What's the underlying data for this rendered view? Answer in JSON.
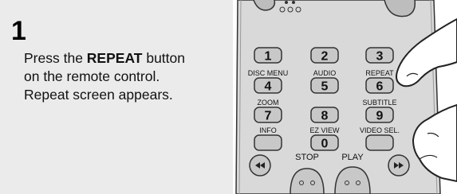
{
  "step": {
    "number": "1"
  },
  "instructions": {
    "line1_pre": "Press the ",
    "line1_bold": "REPEAT",
    "line1_post": " button",
    "line2": "on the remote control.",
    "line3": "Repeat screen appears."
  },
  "remote": {
    "rows": [
      {
        "buttons": [
          {
            "label": "",
            "num": "1"
          },
          {
            "label": "",
            "num": "2"
          },
          {
            "label": "",
            "num": "3"
          }
        ]
      },
      {
        "buttons": [
          {
            "label": "DISC MENU",
            "num": "4"
          },
          {
            "label": "AUDIO",
            "num": "5"
          },
          {
            "label": "REPEAT",
            "num": "6"
          }
        ]
      },
      {
        "buttons": [
          {
            "label": "ZOOM",
            "num": "7"
          },
          {
            "label": "",
            "num": "8"
          },
          {
            "label": "SUBTITLE",
            "num": "9"
          }
        ]
      },
      {
        "buttons": [
          {
            "label": "INFO",
            "num": ""
          },
          {
            "label": "EZ VIEW",
            "num": "0"
          },
          {
            "label": "VIDEO SEL.",
            "num": ""
          }
        ]
      }
    ],
    "transport": {
      "stop": "STOP",
      "play": "PLAY"
    },
    "icons": {
      "rewind": "rewind-icon",
      "fast_forward": "fast-forward-icon",
      "hand": "pointing-hand-icon"
    }
  }
}
